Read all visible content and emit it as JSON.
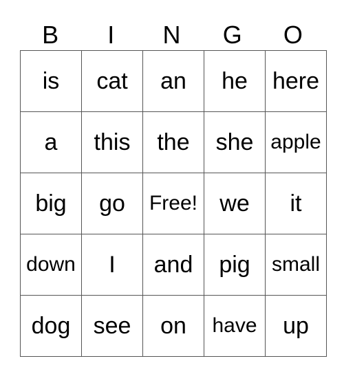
{
  "header": [
    "B",
    "I",
    "N",
    "G",
    "O"
  ],
  "rows": [
    [
      "is",
      "cat",
      "an",
      "he",
      "here"
    ],
    [
      "a",
      "this",
      "the",
      "she",
      "apple"
    ],
    [
      "big",
      "go",
      "Free!",
      "we",
      "it"
    ],
    [
      "down",
      "I",
      "and",
      "pig",
      "small"
    ],
    [
      "dog",
      "see",
      "on",
      "have",
      "up"
    ]
  ]
}
